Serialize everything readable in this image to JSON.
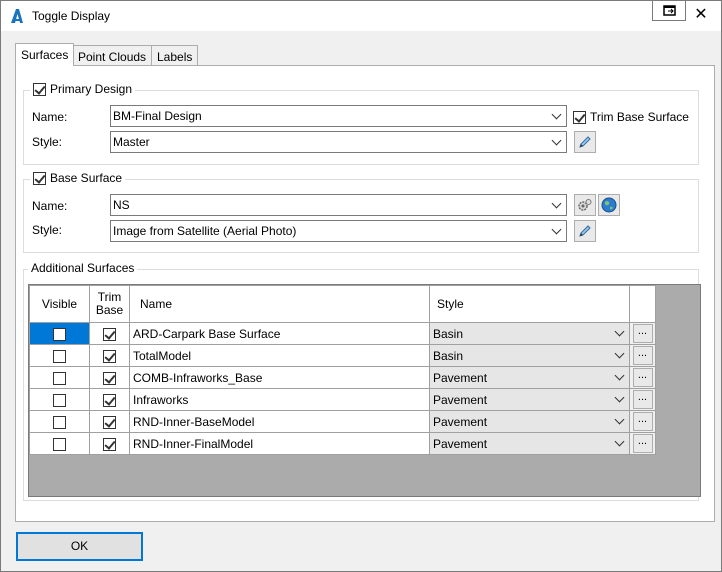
{
  "window": {
    "title": "Toggle Display"
  },
  "tabs": [
    {
      "label": "Surfaces",
      "active": true
    },
    {
      "label": "Point Clouds",
      "active": false
    },
    {
      "label": "Labels",
      "active": false
    }
  ],
  "primary_design": {
    "label": "Primary Design",
    "checked": true,
    "name_label": "Name:",
    "name_value": "BM-Final Design",
    "style_label": "Style:",
    "style_value": "Master",
    "trim_label": "Trim Base Surface",
    "trim_checked": true
  },
  "base_surface": {
    "label": "Base Surface",
    "checked": true,
    "name_label": "Name:",
    "name_value": "NS",
    "style_label": "Style:",
    "style_value": "Image from Satellite (Aerial Photo)"
  },
  "additional_surfaces": {
    "label": "Additional Surfaces",
    "columns": {
      "visible": "Visible",
      "trim_base_1": "Trim",
      "trim_base_2": "Base",
      "name": "Name",
      "style": "Style"
    },
    "button_label": "...",
    "rows": [
      {
        "visible": false,
        "trim_base": true,
        "name": "ARD-Carpark Base Surface",
        "style": "Basin",
        "selected": true
      },
      {
        "visible": false,
        "trim_base": true,
        "name": "TotalModel",
        "style": "Basin",
        "selected": false
      },
      {
        "visible": false,
        "trim_base": true,
        "name": "COMB-Infraworks_Base",
        "style": "Pavement",
        "selected": false
      },
      {
        "visible": false,
        "trim_base": true,
        "name": "Infraworks",
        "style": "Pavement",
        "selected": false
      },
      {
        "visible": false,
        "trim_base": true,
        "name": "RND-Inner-BaseModel",
        "style": "Pavement",
        "selected": false
      },
      {
        "visible": false,
        "trim_base": true,
        "name": "RND-Inner-FinalModel",
        "style": "Pavement",
        "selected": false
      }
    ]
  },
  "footer": {
    "ok_label": "OK"
  },
  "colors": {
    "accent": "#0078d7",
    "grid_background": "#ababab"
  },
  "icons": {
    "app": "autocad-a-icon",
    "restore": "restore-window-icon",
    "close": "close-icon",
    "edit": "pencil-icon",
    "surface_properties": "gear-surface-icon",
    "globe": "globe-icon"
  }
}
